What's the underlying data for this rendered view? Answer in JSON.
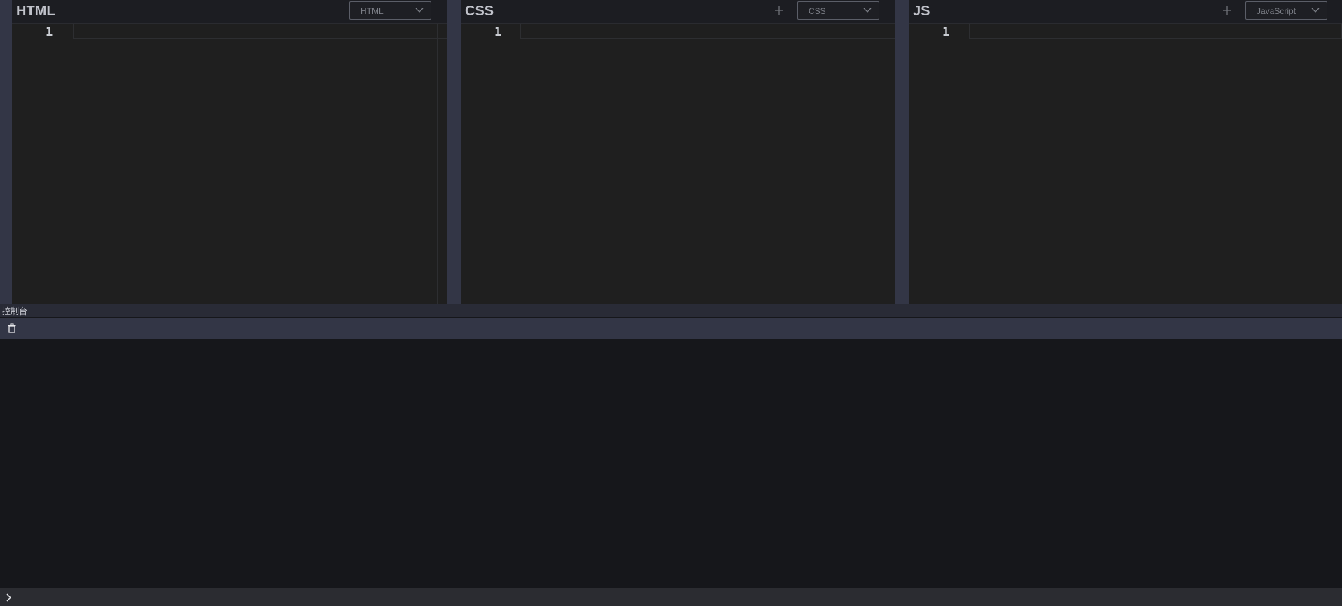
{
  "panels": {
    "html": {
      "title": "HTML",
      "language": "HTML",
      "line_numbers": [
        "1"
      ]
    },
    "css": {
      "title": "CSS",
      "language": "CSS",
      "line_numbers": [
        "1"
      ]
    },
    "js": {
      "title": "JS",
      "language": "JavaScript",
      "line_numbers": [
        "1"
      ]
    }
  },
  "console": {
    "title": "控制台",
    "clear_icon": "trash-icon",
    "prompt_icon": "chevron-right-icon"
  },
  "icons": {
    "add": "plus-icon",
    "dropdown": "chevron-down-icon"
  },
  "colors": {
    "panel_bg": "#1c1d22",
    "editor_bg": "#1f1f1f",
    "divider": "#333646",
    "console_bg": "#16171b"
  }
}
